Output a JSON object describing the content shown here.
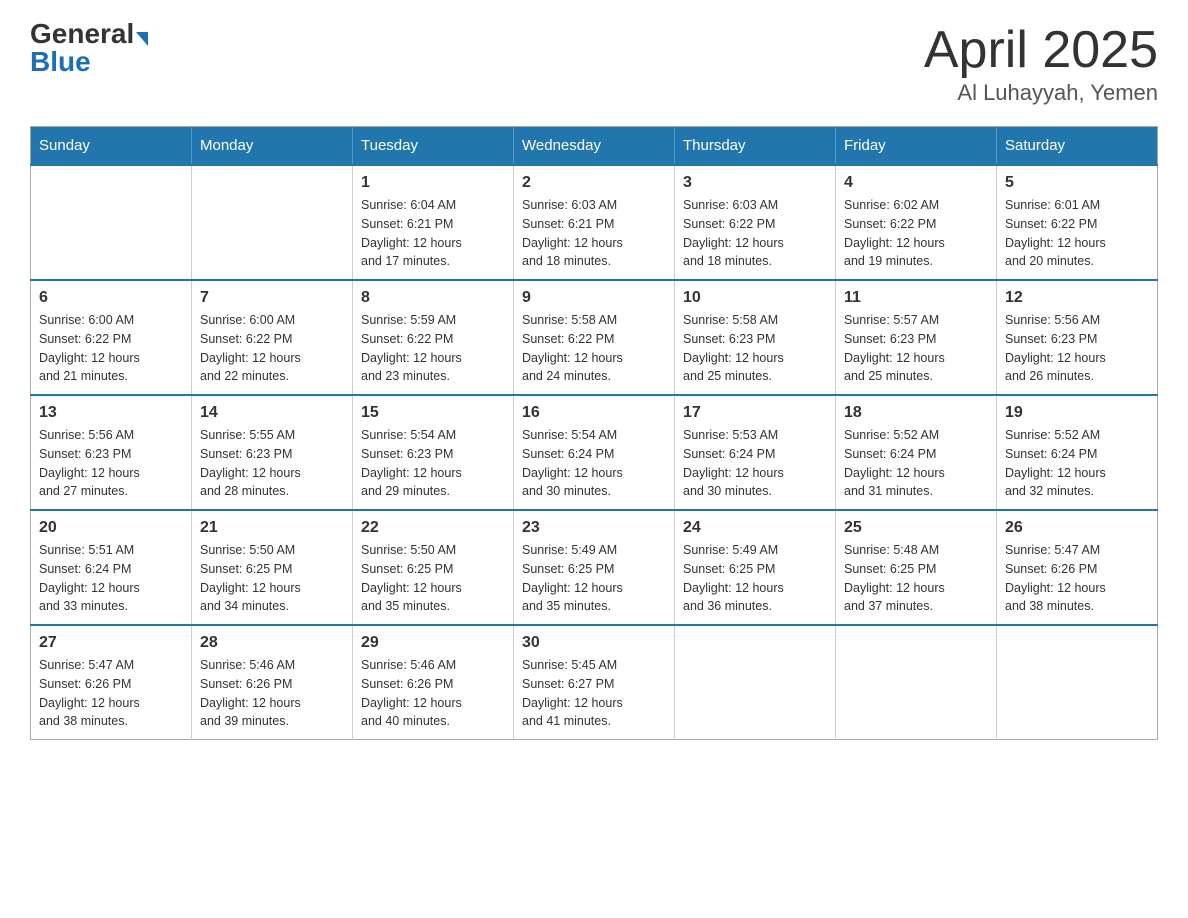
{
  "header": {
    "logo_general": "General",
    "logo_blue": "Blue",
    "title": "April 2025",
    "subtitle": "Al Luhayyah, Yemen"
  },
  "days_of_week": [
    "Sunday",
    "Monday",
    "Tuesday",
    "Wednesday",
    "Thursday",
    "Friday",
    "Saturday"
  ],
  "weeks": [
    [
      {
        "day": "",
        "info": ""
      },
      {
        "day": "",
        "info": ""
      },
      {
        "day": "1",
        "info": "Sunrise: 6:04 AM\nSunset: 6:21 PM\nDaylight: 12 hours\nand 17 minutes."
      },
      {
        "day": "2",
        "info": "Sunrise: 6:03 AM\nSunset: 6:21 PM\nDaylight: 12 hours\nand 18 minutes."
      },
      {
        "day": "3",
        "info": "Sunrise: 6:03 AM\nSunset: 6:22 PM\nDaylight: 12 hours\nand 18 minutes."
      },
      {
        "day": "4",
        "info": "Sunrise: 6:02 AM\nSunset: 6:22 PM\nDaylight: 12 hours\nand 19 minutes."
      },
      {
        "day": "5",
        "info": "Sunrise: 6:01 AM\nSunset: 6:22 PM\nDaylight: 12 hours\nand 20 minutes."
      }
    ],
    [
      {
        "day": "6",
        "info": "Sunrise: 6:00 AM\nSunset: 6:22 PM\nDaylight: 12 hours\nand 21 minutes."
      },
      {
        "day": "7",
        "info": "Sunrise: 6:00 AM\nSunset: 6:22 PM\nDaylight: 12 hours\nand 22 minutes."
      },
      {
        "day": "8",
        "info": "Sunrise: 5:59 AM\nSunset: 6:22 PM\nDaylight: 12 hours\nand 23 minutes."
      },
      {
        "day": "9",
        "info": "Sunrise: 5:58 AM\nSunset: 6:22 PM\nDaylight: 12 hours\nand 24 minutes."
      },
      {
        "day": "10",
        "info": "Sunrise: 5:58 AM\nSunset: 6:23 PM\nDaylight: 12 hours\nand 25 minutes."
      },
      {
        "day": "11",
        "info": "Sunrise: 5:57 AM\nSunset: 6:23 PM\nDaylight: 12 hours\nand 25 minutes."
      },
      {
        "day": "12",
        "info": "Sunrise: 5:56 AM\nSunset: 6:23 PM\nDaylight: 12 hours\nand 26 minutes."
      }
    ],
    [
      {
        "day": "13",
        "info": "Sunrise: 5:56 AM\nSunset: 6:23 PM\nDaylight: 12 hours\nand 27 minutes."
      },
      {
        "day": "14",
        "info": "Sunrise: 5:55 AM\nSunset: 6:23 PM\nDaylight: 12 hours\nand 28 minutes."
      },
      {
        "day": "15",
        "info": "Sunrise: 5:54 AM\nSunset: 6:23 PM\nDaylight: 12 hours\nand 29 minutes."
      },
      {
        "day": "16",
        "info": "Sunrise: 5:54 AM\nSunset: 6:24 PM\nDaylight: 12 hours\nand 30 minutes."
      },
      {
        "day": "17",
        "info": "Sunrise: 5:53 AM\nSunset: 6:24 PM\nDaylight: 12 hours\nand 30 minutes."
      },
      {
        "day": "18",
        "info": "Sunrise: 5:52 AM\nSunset: 6:24 PM\nDaylight: 12 hours\nand 31 minutes."
      },
      {
        "day": "19",
        "info": "Sunrise: 5:52 AM\nSunset: 6:24 PM\nDaylight: 12 hours\nand 32 minutes."
      }
    ],
    [
      {
        "day": "20",
        "info": "Sunrise: 5:51 AM\nSunset: 6:24 PM\nDaylight: 12 hours\nand 33 minutes."
      },
      {
        "day": "21",
        "info": "Sunrise: 5:50 AM\nSunset: 6:25 PM\nDaylight: 12 hours\nand 34 minutes."
      },
      {
        "day": "22",
        "info": "Sunrise: 5:50 AM\nSunset: 6:25 PM\nDaylight: 12 hours\nand 35 minutes."
      },
      {
        "day": "23",
        "info": "Sunrise: 5:49 AM\nSunset: 6:25 PM\nDaylight: 12 hours\nand 35 minutes."
      },
      {
        "day": "24",
        "info": "Sunrise: 5:49 AM\nSunset: 6:25 PM\nDaylight: 12 hours\nand 36 minutes."
      },
      {
        "day": "25",
        "info": "Sunrise: 5:48 AM\nSunset: 6:25 PM\nDaylight: 12 hours\nand 37 minutes."
      },
      {
        "day": "26",
        "info": "Sunrise: 5:47 AM\nSunset: 6:26 PM\nDaylight: 12 hours\nand 38 minutes."
      }
    ],
    [
      {
        "day": "27",
        "info": "Sunrise: 5:47 AM\nSunset: 6:26 PM\nDaylight: 12 hours\nand 38 minutes."
      },
      {
        "day": "28",
        "info": "Sunrise: 5:46 AM\nSunset: 6:26 PM\nDaylight: 12 hours\nand 39 minutes."
      },
      {
        "day": "29",
        "info": "Sunrise: 5:46 AM\nSunset: 6:26 PM\nDaylight: 12 hours\nand 40 minutes."
      },
      {
        "day": "30",
        "info": "Sunrise: 5:45 AM\nSunset: 6:27 PM\nDaylight: 12 hours\nand 41 minutes."
      },
      {
        "day": "",
        "info": ""
      },
      {
        "day": "",
        "info": ""
      },
      {
        "day": "",
        "info": ""
      }
    ]
  ]
}
